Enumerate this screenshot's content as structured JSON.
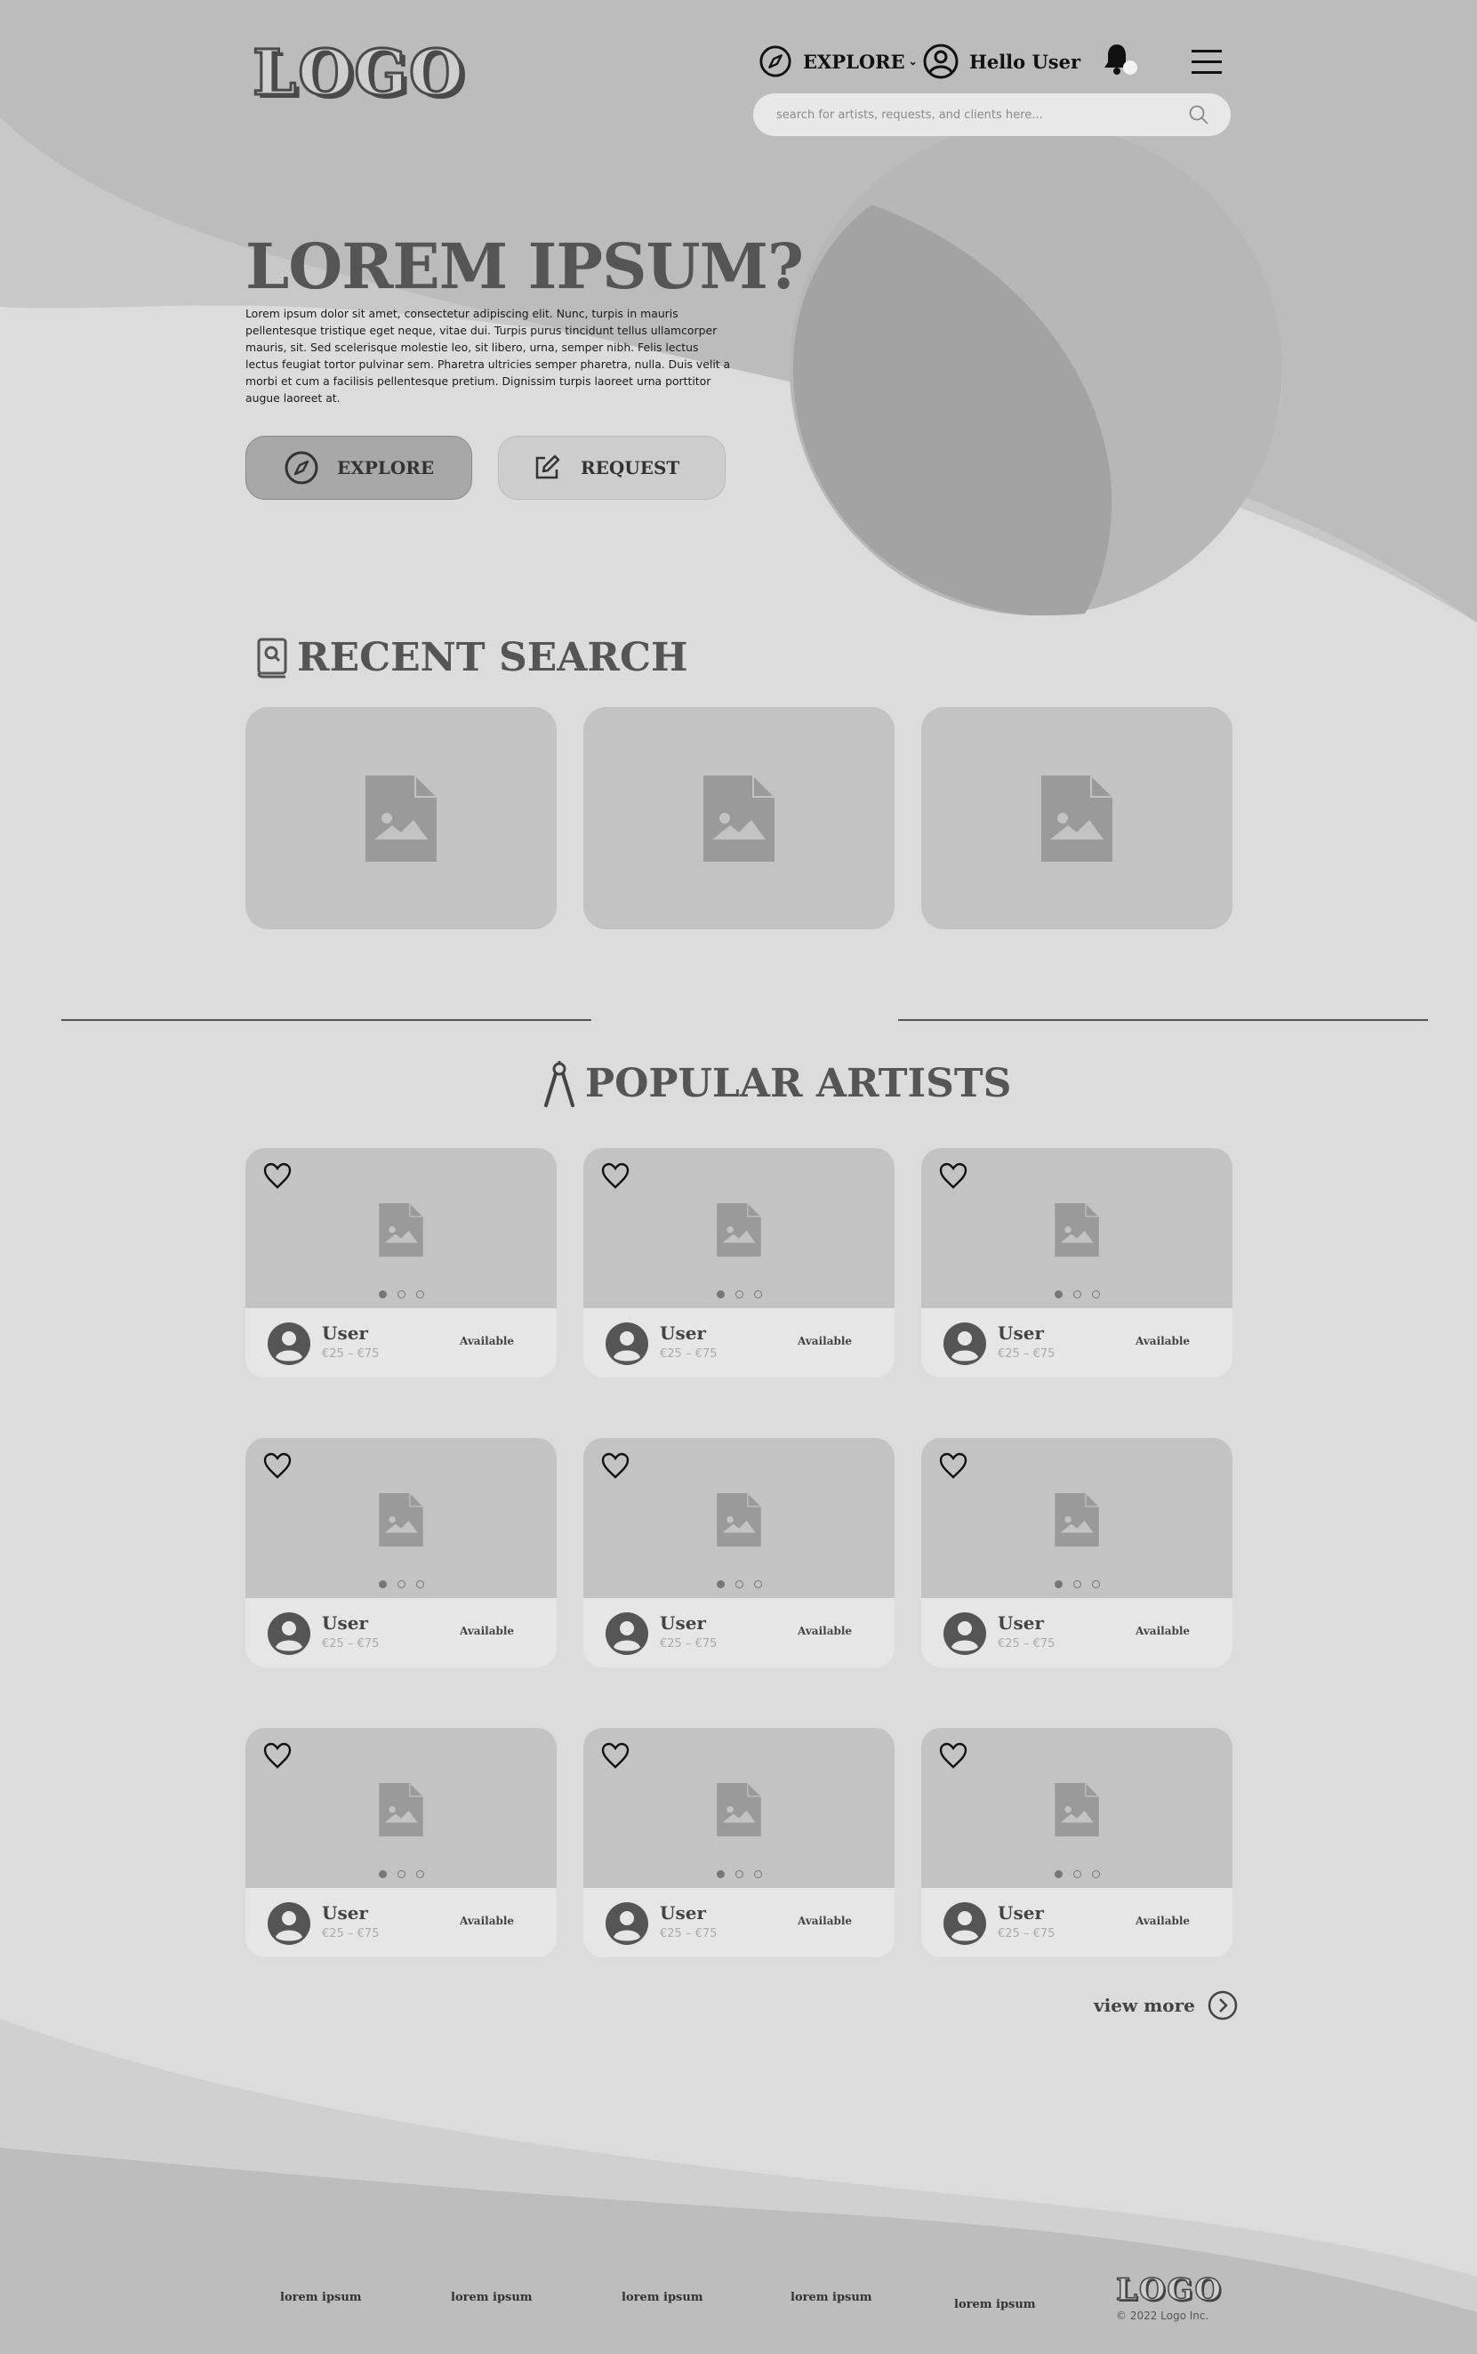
{
  "header": {
    "logo": "LOGO",
    "explore_label": "EXPLORE",
    "user_label": "Hello User",
    "search_placeholder": "search for artists, requests, and clients here..."
  },
  "hero": {
    "title": "LOREM IPSUM?",
    "text": "Lorem ipsum dolor sit amet, consectetur adipiscing elit. Nunc, turpis in mauris pellentesque tristique eget neque, vitae dui. Turpis purus tincidunt tellus ullamcorper mauris, sit. Sed scelerisque molestie leo, sit libero, urna, semper nibh. Felis lectus lectus feugiat tortor pulvinar sem. Pharetra ultricies semper pharetra, nulla. Duis velit a morbi et cum a facilisis pellentesque pretium. Dignissim turpis laoreet urna porttitor augue laoreet at.",
    "explore_button": "EXPLORE",
    "request_button": "REQUEST"
  },
  "recent": {
    "title": "RECENT SEARCH"
  },
  "popular": {
    "title": "POPULAR ARTISTS",
    "artists": [
      {
        "name": "User",
        "price": "€25 – €75",
        "status": "Available"
      },
      {
        "name": "User",
        "price": "€25 – €75",
        "status": "Available"
      },
      {
        "name": "User",
        "price": "€25 – €75",
        "status": "Available"
      },
      {
        "name": "User",
        "price": "€25 – €75",
        "status": "Available"
      },
      {
        "name": "User",
        "price": "€25 – €75",
        "status": "Available"
      },
      {
        "name": "User",
        "price": "€25 – €75",
        "status": "Available"
      },
      {
        "name": "User",
        "price": "€25 – €75",
        "status": "Available"
      },
      {
        "name": "User",
        "price": "€25 – €75",
        "status": "Available"
      },
      {
        "name": "User",
        "price": "€25 – €75",
        "status": "Available"
      }
    ],
    "view_more": "view more"
  },
  "footer": {
    "links": [
      "lorem ipsum",
      "lorem ipsum",
      "lorem ipsum",
      "lorem ipsum",
      "lorem ipsum"
    ],
    "logo": "LOGO",
    "copyright": "© 2022 Logo Inc."
  },
  "colors": {
    "background": "#dcdcdc",
    "card": "#c3c3c3",
    "icon": "#9a9a9a",
    "heading": "#555555"
  }
}
